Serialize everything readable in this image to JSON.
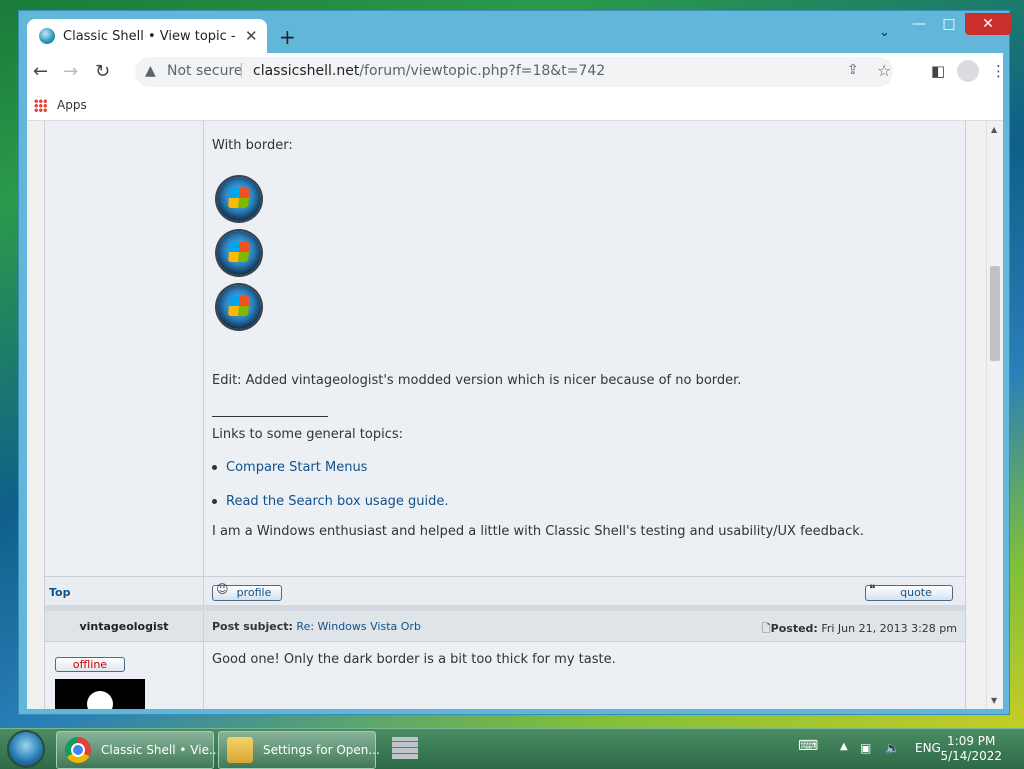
{
  "browser": {
    "tab_title": "Classic Shell • View topic - Windows Vista Orb",
    "url_warning": "Not secure",
    "url_domain": "classicshell.net",
    "url_path": "/forum/viewtopic.php?f=18&t=742",
    "bookmarks": [
      {
        "label": "Apps"
      }
    ]
  },
  "post1": {
    "with_border": "With border:",
    "edit_note": "Edit: Added vintageologist's modded version which is nicer because of no border.",
    "links_heading": "Links to some general topics:",
    "link1": "Compare Start Menus",
    "link2": "Read the Search box usage guide.",
    "signature": "I am a Windows enthusiast and helped a little with Classic Shell's testing and usability/UX feedback.",
    "top_link": "Top",
    "profile_btn": "profile",
    "quote_btn": "quote"
  },
  "post2": {
    "author": "vintageologist",
    "subject_label": "Post subject:",
    "subject": "Re: Windows Vista Orb",
    "posted_label": "Posted:",
    "posted_date": "Fri Jun 21, 2013 3:28 pm",
    "status": "offline",
    "text": "Good one! Only the dark border is a bit too thick for my taste."
  },
  "taskbar": {
    "items": [
      {
        "label": "Classic Shell • Vie..."
      },
      {
        "label": "Settings for Open..."
      }
    ],
    "lang": "ENG",
    "time": "1:09 PM",
    "date": "5/14/2022"
  }
}
